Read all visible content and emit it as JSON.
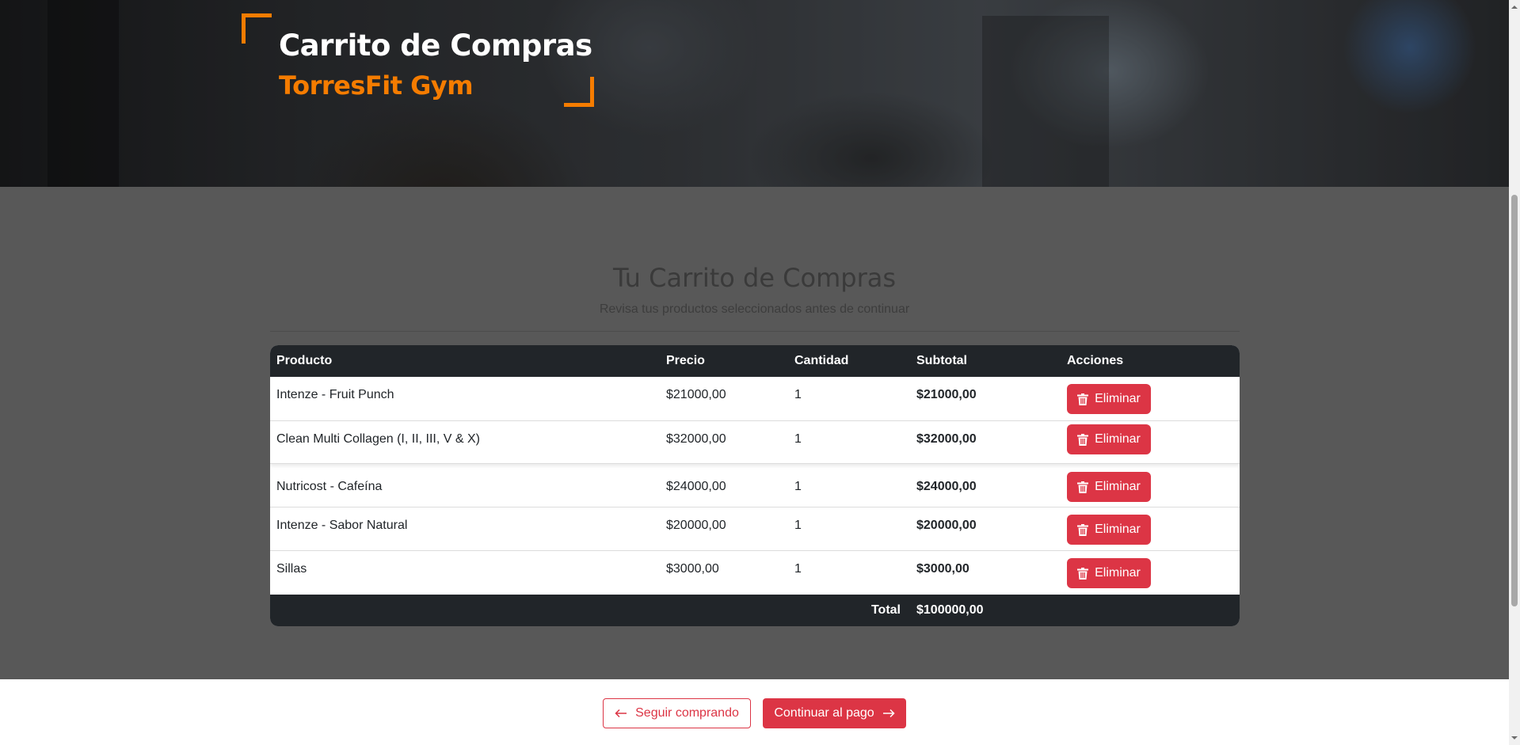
{
  "hero": {
    "title": "Carrito de Compras",
    "subtitle": "TorresFit Gym"
  },
  "cart": {
    "heading": "Tu Carrito de Compras",
    "lead": "Revisa tus productos seleccionados antes de continuar",
    "columns": [
      "Producto",
      "Precio",
      "Cantidad",
      "Subtotal",
      "Acciones"
    ],
    "rows": [
      {
        "product": "Intenze - Fruit Punch",
        "price": "$21000,00",
        "qty": "1",
        "subtotal": "$21000,00",
        "action": "Eliminar"
      },
      {
        "product": "Clean Multi Collagen (I, II, III, V & X)",
        "price": "$32000,00",
        "qty": "1",
        "subtotal": "$32000,00",
        "action": "Eliminar"
      },
      {
        "product": "Nutricost - Cafeína",
        "price": "$24000,00",
        "qty": "1",
        "subtotal": "$24000,00",
        "action": "Eliminar"
      },
      {
        "product": "Intenze - Sabor Natural",
        "price": "$20000,00",
        "qty": "1",
        "subtotal": "$20000,00",
        "action": "Eliminar"
      },
      {
        "product": "Sillas",
        "price": "$3000,00",
        "qty": "1",
        "subtotal": "$3000,00",
        "action": "Eliminar"
      }
    ],
    "total_label": "Total",
    "total_value": "$100000,00"
  },
  "actions": {
    "continue_shopping": "Seguir comprando",
    "checkout": "Continuar al pago"
  },
  "colors": {
    "accent": "#f57c00",
    "danger": "#dc3545",
    "table_header": "#212529",
    "section_bg": "#585858"
  }
}
